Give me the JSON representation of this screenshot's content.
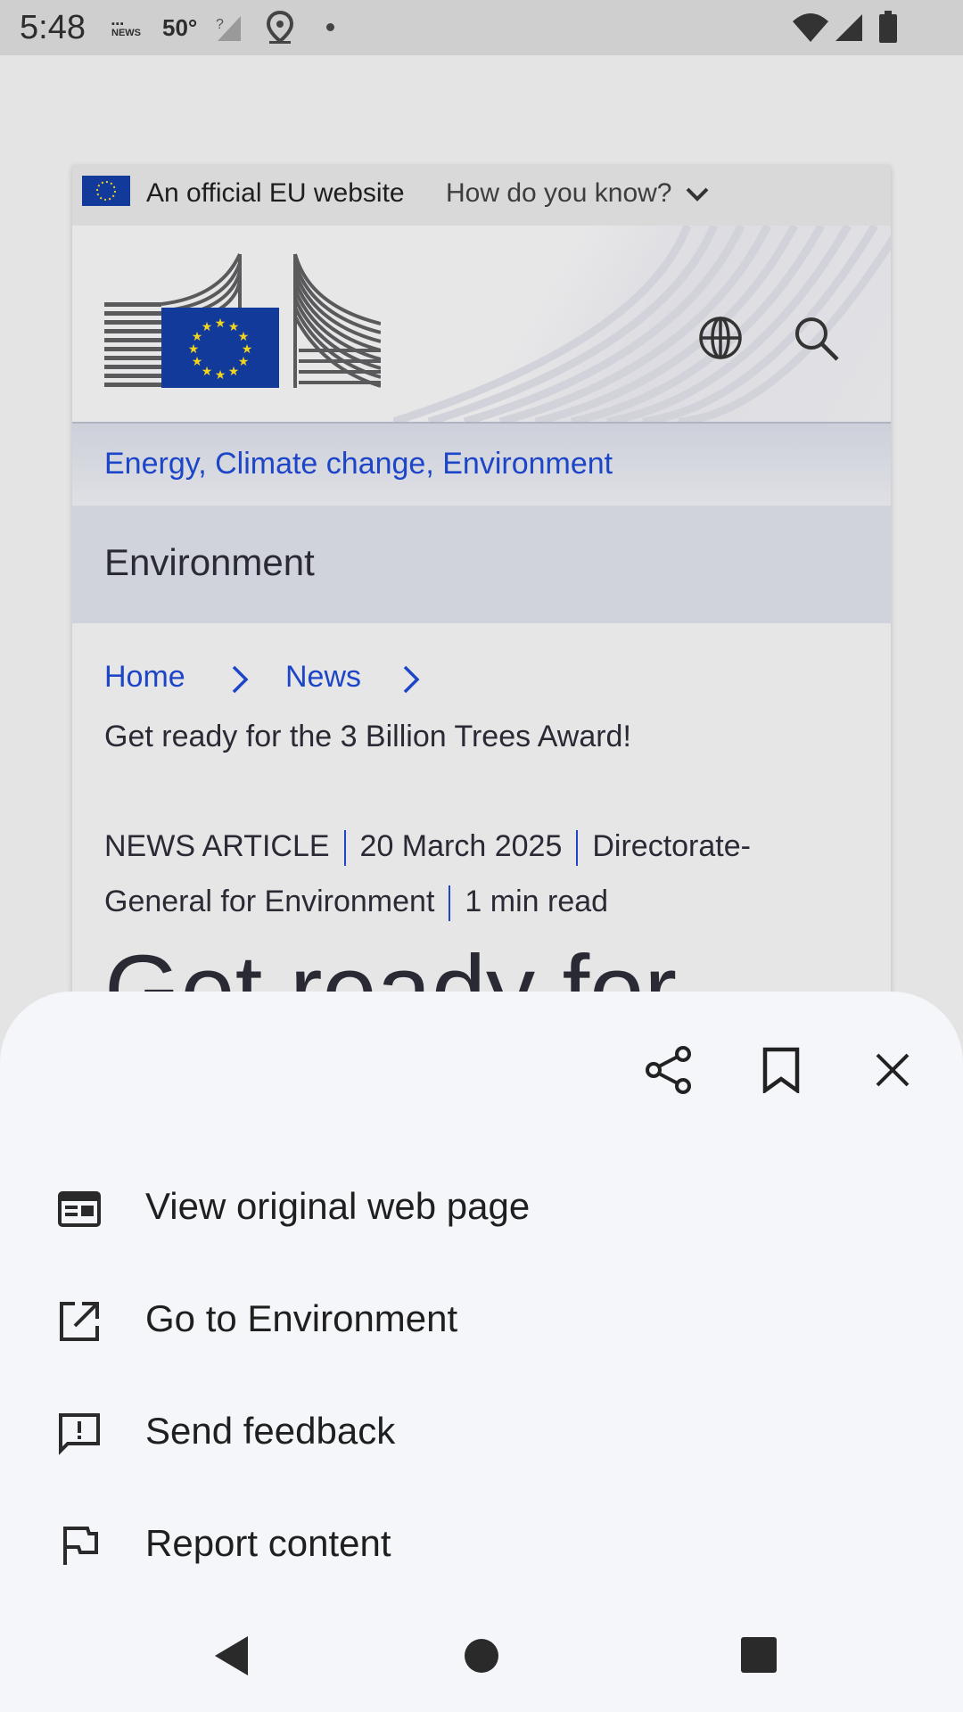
{
  "status_bar": {
    "time": "5:48",
    "temperature": "50°",
    "news_label": "NEWS",
    "icons": [
      "news-icon",
      "weather-icon",
      "signal-icon",
      "location-icon",
      "dot-icon",
      "wifi-icon",
      "cell-signal-icon",
      "battery-icon"
    ]
  },
  "webpage": {
    "eu_banner": {
      "official_text": "An official EU website",
      "how_text": "How do you know?"
    },
    "topic": "Energy, Climate change, Environment",
    "section_title": "Environment",
    "breadcrumb": [
      "Home",
      "News"
    ],
    "article_title": "Get ready for the 3 Billion Trees Award!",
    "meta": {
      "type": "NEWS ARTICLE",
      "date": "20 March 2025",
      "author_line1": "Directorate-",
      "author_line2": "General for Environment",
      "read_time": "1 min read"
    },
    "heading_partial": "Get ready for"
  },
  "sheet": {
    "actions": [
      "share-icon",
      "bookmark-icon",
      "close-icon"
    ],
    "menu": [
      {
        "label": "View original web page",
        "icon": "web-page-icon"
      },
      {
        "label": "Go to Environment",
        "icon": "open-external-icon"
      },
      {
        "label": "Send feedback",
        "icon": "feedback-icon"
      },
      {
        "label": "Report content",
        "icon": "flag-icon"
      }
    ]
  },
  "nav": [
    "back-icon",
    "home-icon",
    "recents-icon"
  ],
  "colors": {
    "link": "#1d45c8",
    "sheet_bg": "#f5f6fa",
    "eu_blue": "#123a9a",
    "eu_star": "#f2d41f"
  }
}
